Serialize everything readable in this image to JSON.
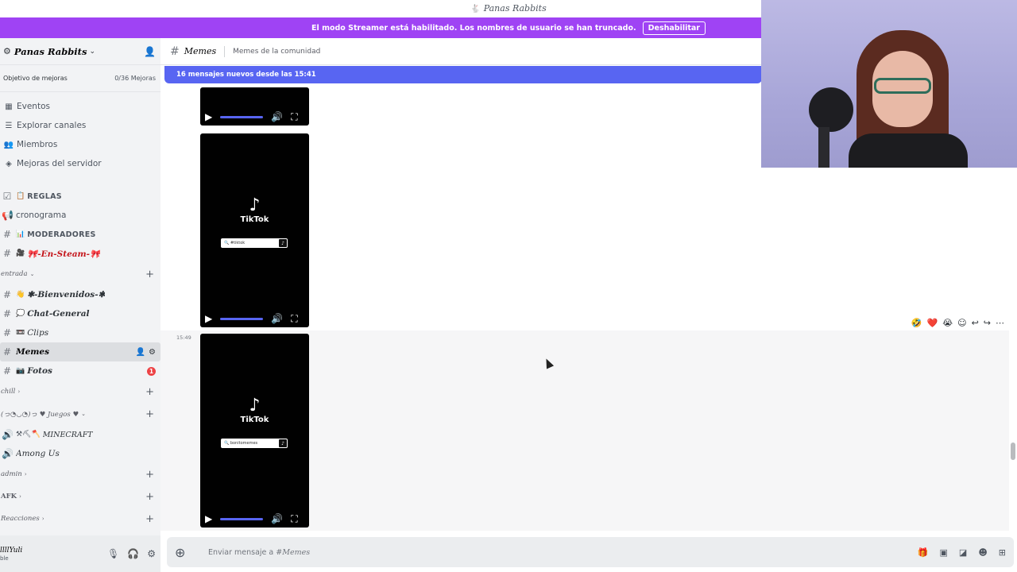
{
  "title_bar": {
    "title": "Panas Rabbits"
  },
  "streamer_banner": {
    "message": "El modo Streamer está habilitado. Los nombres de usuario se han truncado.",
    "button_label": "Deshabilitar"
  },
  "sidebar": {
    "server_name": "Panas Rabbits",
    "boost": {
      "label": "Objetivo de mejoras",
      "count": "0/36 Mejoras"
    },
    "nav_items": [
      {
        "label": "Eventos",
        "icon": "calendar-icon"
      },
      {
        "label": "Explorar canales",
        "icon": "browse-icon"
      },
      {
        "label": "Miembros",
        "icon": "members-icon"
      },
      {
        "label": "Mejoras del servidor",
        "icon": "boost-icon"
      }
    ],
    "channels_top": [
      {
        "emoji": "📋",
        "name": "REGLAS"
      },
      {
        "emoji": "",
        "name": "cronograma"
      },
      {
        "emoji": "📊",
        "name": "MODERADORES"
      },
      {
        "emoji": "🎥",
        "name": "🎀-En-Steam-🎀"
      }
    ],
    "category_entrada": "entrada",
    "channels_entrada": [
      {
        "emoji": "👋",
        "name": "✱-Bienvenidos-✱"
      },
      {
        "emoji": "💭",
        "name": "Chat-General"
      },
      {
        "emoji": "📼",
        "name": "Clips"
      },
      {
        "emoji": "",
        "name": "Memes"
      },
      {
        "emoji": "📷",
        "name": "Fotos",
        "badge": "1"
      }
    ],
    "category_chill": "chill",
    "category_juegos": "(っ◔◡◔)っ ♥ Juegos ♥",
    "voice_channels": [
      {
        "name": "MINECRAFT",
        "prefix": "⚒⛏🪓"
      },
      {
        "name": "Among Us",
        "prefix": ""
      }
    ],
    "category_admin": "admin",
    "category_afk": "AFK",
    "category_reacciones": "Reacciones",
    "user": {
      "name": "llllYuli",
      "status": "ble"
    }
  },
  "channel_header": {
    "name": "Memes",
    "topic": "Memes de la comunidad"
  },
  "new_messages_bar": "16 mensajes nuevos desde las 15:41",
  "messages": {
    "timestamp": "15:49",
    "video_brand": "TikTok",
    "video_search_1": "🔍 #tiktok",
    "video_search_2": "🔍 bonitomemes"
  },
  "reactions": [
    "🤣",
    "❤️",
    "😭"
  ],
  "composer": {
    "placeholder_prefix": "Enviar mensaje a #",
    "placeholder_channel": "Memes"
  }
}
